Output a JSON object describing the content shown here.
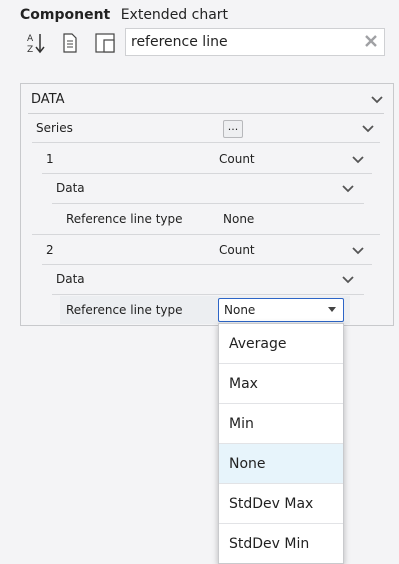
{
  "header": {
    "title": "Component",
    "subtitle": "Extended chart"
  },
  "toolbar": {
    "sort_icon": "sort-az-icon",
    "document_icon": "document-icon",
    "layout_icon": "layout-icon"
  },
  "search": {
    "value": "reference line",
    "placeholder": ""
  },
  "panel": {
    "section_title": "DATA",
    "series_label": "Series",
    "series_button": "...",
    "series": [
      {
        "index": "1",
        "aggregate": "Count",
        "data_label": "Data",
        "ref_label": "Reference line type",
        "ref_value": "None"
      },
      {
        "index": "2",
        "aggregate": "Count",
        "data_label": "Data",
        "ref_label": "Reference line type",
        "ref_value": "None"
      }
    ]
  },
  "dropdown": {
    "options": [
      "Average",
      "Max",
      "Min",
      "None",
      "StdDev Max",
      "StdDev Min"
    ],
    "selected": "None"
  },
  "colors": {
    "accent": "#2d65c7",
    "selected_bg": "#e7f4fb"
  }
}
